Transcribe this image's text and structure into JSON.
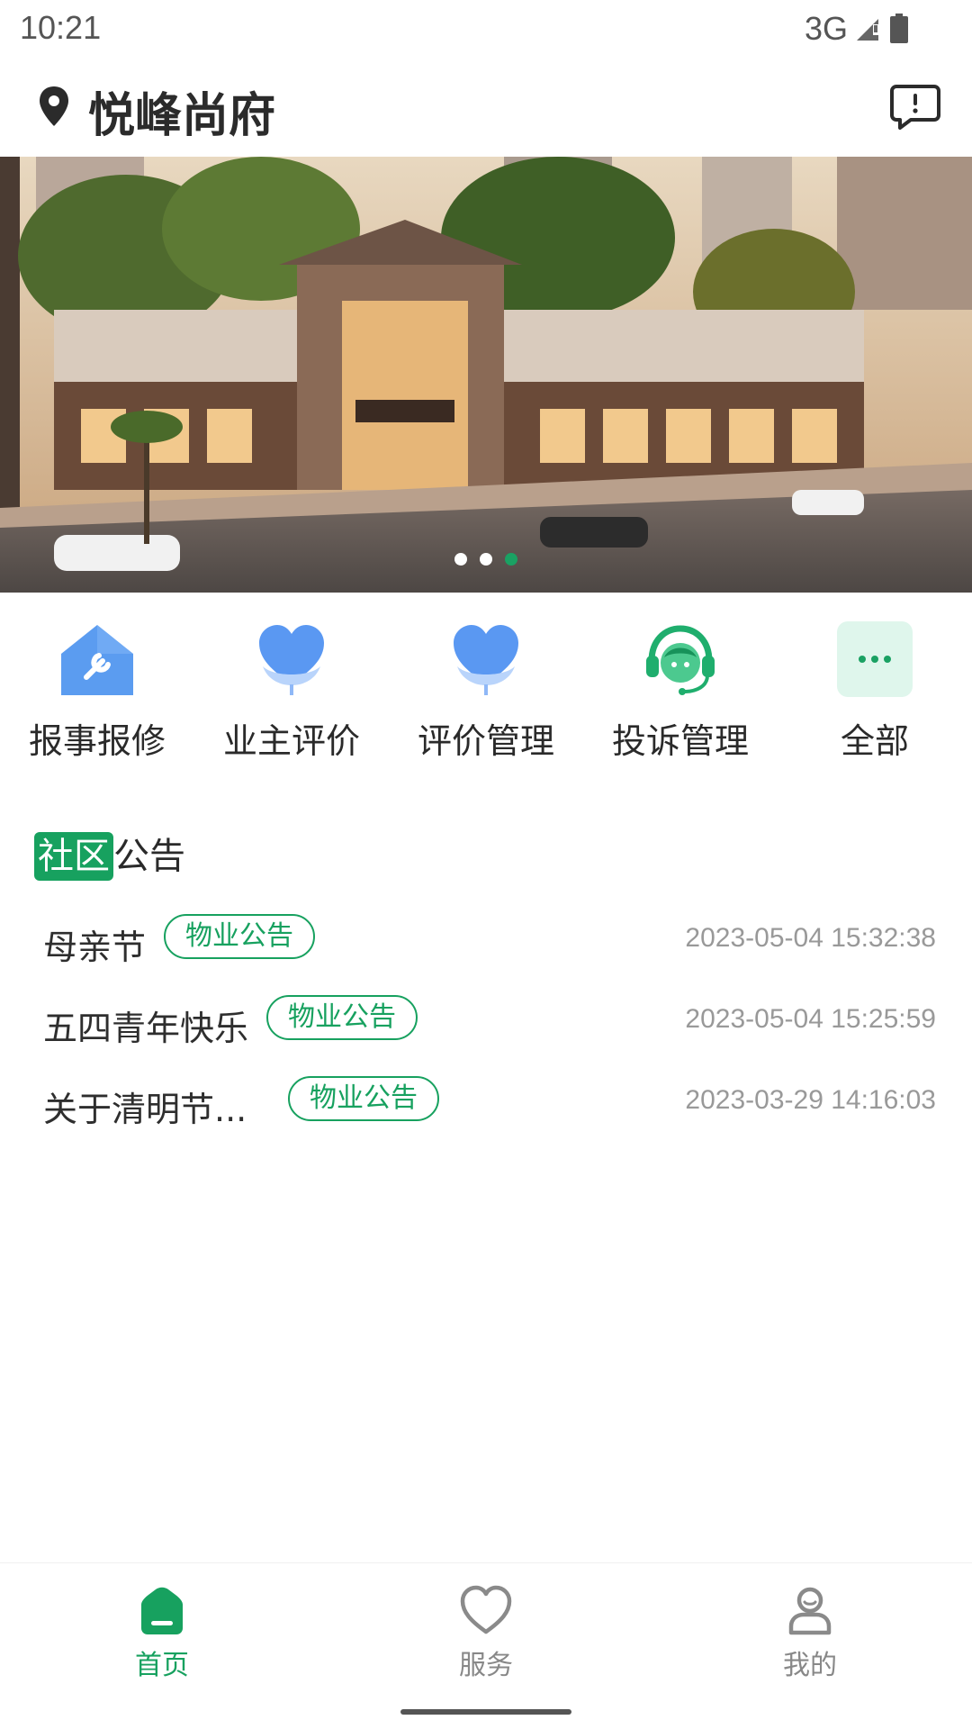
{
  "status_bar": {
    "time": "10:21",
    "network": "3G",
    "icons": [
      "signal-icon",
      "battery-icon"
    ]
  },
  "header": {
    "community_name": "悦峰尚府",
    "icons": [
      "location-pin-icon",
      "message-icon"
    ]
  },
  "banner": {
    "slide_count": 3,
    "active_slide": 3
  },
  "quick_menu": [
    {
      "label": "报事报修",
      "icon": "repair-house-icon"
    },
    {
      "label": "业主评价",
      "icon": "heart-flower-icon"
    },
    {
      "label": "评价管理",
      "icon": "heart-flower-icon"
    },
    {
      "label": "投诉管理",
      "icon": "customer-service-icon"
    },
    {
      "label": "全部",
      "icon": "more-icon"
    }
  ],
  "notices": {
    "title_highlight": "社区",
    "title_rest": "公告",
    "items": [
      {
        "title": "母亲节",
        "tag": "物业公告",
        "date": "2023-05-04 15:32:38"
      },
      {
        "title": "五四青年快乐",
        "tag": "物业公告",
        "date": "2023-05-04 15:25:59"
      },
      {
        "title": "关于清明节...",
        "tag": "物业公告",
        "date": "2023-03-29 14:16:03"
      }
    ]
  },
  "tab_bar": {
    "active": "home",
    "tabs": [
      {
        "label": "首页",
        "icon": "home-icon"
      },
      {
        "label": "服务",
        "icon": "heart-icon"
      },
      {
        "label": "我的",
        "icon": "profile-icon"
      }
    ]
  },
  "colors": {
    "accent": "#17a15f",
    "text": "#2a2a2a",
    "muted": "#999999"
  }
}
